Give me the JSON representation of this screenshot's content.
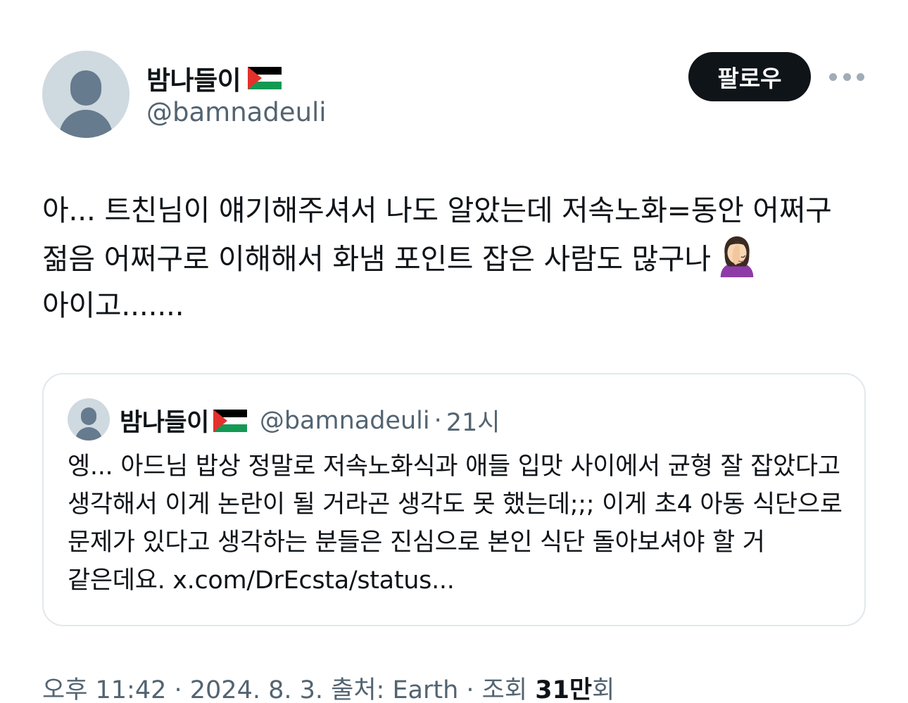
{
  "author": {
    "display_name": "밤나들이",
    "handle": "@bamnadeuli",
    "flag_icon": "palestine-flag-icon"
  },
  "actions": {
    "follow_label": "팔로우",
    "more_icon": "more-dots-icon"
  },
  "tweet": {
    "text": "아... 트친님이 얘기해주셔서 나도 알았는데 저속노화=동안 어쩌구 젊음 어쩌구로 이해해서 화냄 포인트 잡은 사람도 많구나",
    "text_end": "아이고.......",
    "emoji": "woman-facepalming-emoji"
  },
  "quote": {
    "display_name": "밤나들이",
    "handle": "@bamnadeuli",
    "separator": "·",
    "time": "21시",
    "text": "엥... 아드님 밥상 정말로 저속노화식과 애들 입맛 사이에서 균형 잘 잡았다고 생각해서 이게 논란이 될 거라곤 생각도 못 했는데;;; 이게 초4 아동 식단으로 문제가 있다고 생각하는 분들은 진심으로 본인 식단 돌아보셔야 할 거 같은데요. x.com/DrEcsta/status..."
  },
  "meta": {
    "timestamp": "오후 11:42 · 2024. 8. 3. 출처: Earth · 조회 ",
    "views_count": "31만",
    "views_suffix": "회"
  },
  "colors": {
    "text_primary": "#0f1419",
    "text_secondary": "#536471",
    "follow_bg": "#0f1419",
    "border": "#e1e8ed",
    "avatar_bg": "#cfd9e0"
  }
}
